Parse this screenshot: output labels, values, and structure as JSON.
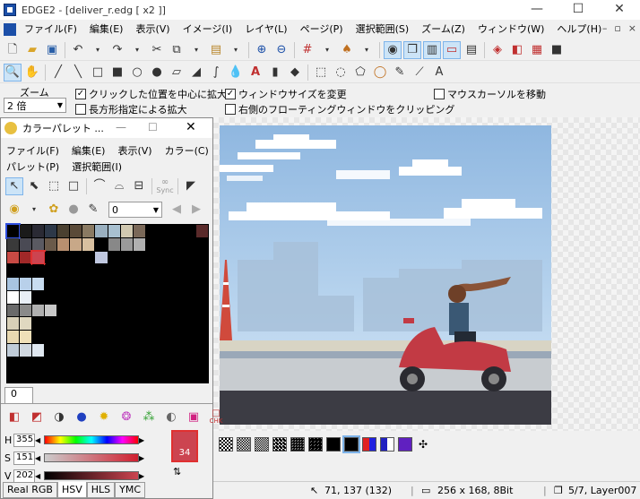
{
  "window": {
    "title": "EDGE2 - [deliver_r.edg [ x2 ]]"
  },
  "menu": [
    "ファイル(F)",
    "編集(E)",
    "表示(V)",
    "イメージ(I)",
    "レイヤ(L)",
    "ページ(P)",
    "選択範囲(S)",
    "ズーム(Z)",
    "ウィンドウ(W)",
    "ヘルプ(H)"
  ],
  "zoom": {
    "label": "ズーム",
    "value": "2 倍"
  },
  "options": {
    "click_center": "クリックした位置を中心に拡大",
    "window_resize": "ウィンドウサイズを変更",
    "move_cursor": "マウスカーソルを移動",
    "rect_zoom": "長方形指定による拡大",
    "clip_floating": "右側のフローティングウィンドウをクリッピング"
  },
  "palette": {
    "title": "カラーパレット ...",
    "menu1": [
      "ファイル(F)",
      "編集(E)",
      "表示(V)",
      "カラー(C)"
    ],
    "menu2": [
      "パレット(P)",
      "選択範囲(I)"
    ],
    "sync_label": "Sync",
    "index_value": "0",
    "tab_label": "0",
    "hsv": {
      "h_label": "H",
      "h": "355",
      "s_label": "S",
      "s": "151",
      "v_label": "V",
      "v": "202"
    },
    "swatch_index": "34",
    "bg_index": "0",
    "chk_label": "CHK",
    "modes": [
      "Real RGB",
      "HSV",
      "HLS",
      "YMC"
    ]
  },
  "status": {
    "cursor": "71, 137 (132)",
    "size": "256 x 168, 8Bit",
    "layer": "5/7, Layer007"
  },
  "colors": {
    "accent_blue": "#1b4fa8",
    "fg_red": "#cc4450",
    "selection": "#cce4f7"
  },
  "icons": [
    "zoom-icon",
    "hand-icon",
    "pen-icon",
    "line-icon",
    "rect-icon",
    "fill-rect-icon",
    "circle-icon",
    "fill-circle-icon",
    "polygon-icon",
    "fill-polygon-icon",
    "curve-icon",
    "bucket-icon",
    "text-icon",
    "eraser-icon",
    "dropper-icon"
  ]
}
